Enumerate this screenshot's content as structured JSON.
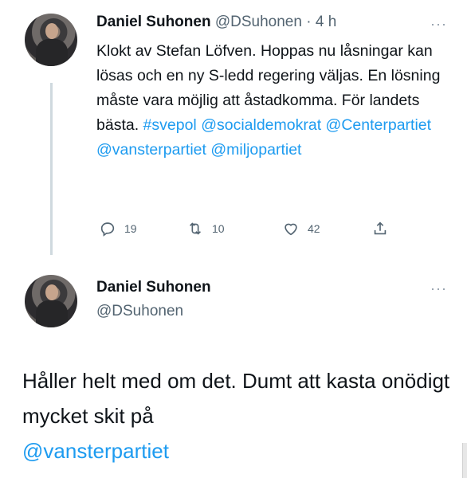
{
  "tweet1": {
    "author_name": "Daniel Suhonen",
    "handle": "@DSuhonen",
    "separator": "·",
    "time": "4 h",
    "more_label": "···",
    "text_plain": "Klokt av Stefan Löfven. Hoppas nu låsningar kan lösas och en ny S-ledd regering väljas. En lösning måste vara möjlig att åstadkomma. För landets bästa.",
    "hashtag": "#svepol",
    "mentions": [
      "@socialdemokrat",
      "@Centerpartiet",
      "@vansterpartiet",
      "@miljopartiet"
    ],
    "replies": "19",
    "retweets": "10",
    "likes": "42",
    "icons": [
      "reply-icon",
      "retweet-icon",
      "like-icon",
      "share-icon"
    ]
  },
  "tweet2": {
    "author_name": "Daniel Suhonen",
    "handle": "@DSuhonen",
    "more_label": "···",
    "text_plain": "Håller helt med om det. Dumt att kasta onödigt mycket skit på",
    "mention": "@vansterpartiet"
  },
  "colors": {
    "link": "#1d9bf0",
    "text": "#0f1419",
    "muted": "#536471",
    "thread_line": "#cfd9de"
  }
}
